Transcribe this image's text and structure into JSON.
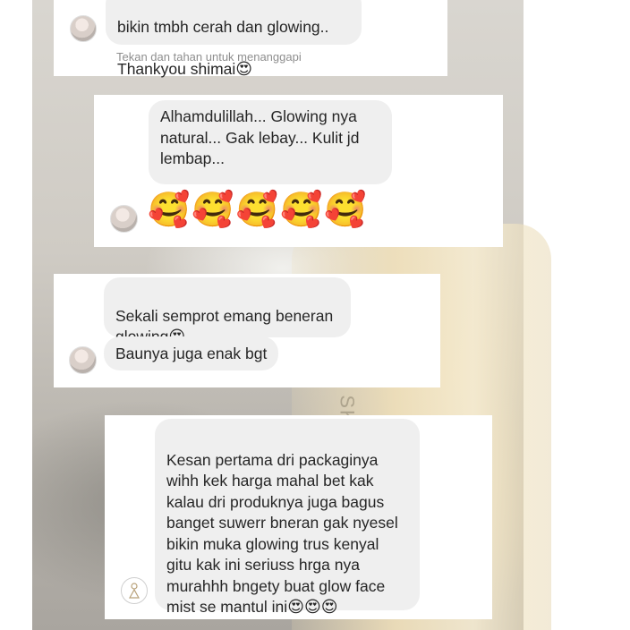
{
  "messages": [
    {
      "text_line1": "bikin tmbh  cerah dan glowing..",
      "text_line2": "Thankyou shimai",
      "emoji": "😍",
      "hint": "Tekan dan tahan untuk menanggapi"
    },
    {
      "text": "Alhamdulillah... Glowing nya\nnatural... Gak lebay... Kulit jd\nlembap...",
      "reaction_emojis": [
        "🥰",
        "🥰",
        "🥰",
        "🥰",
        "🥰"
      ]
    },
    {
      "text": "Sekali semprot emang beneran\nglowing",
      "emoji": "😍",
      "text2": "Baunya juga enak bgt"
    },
    {
      "text": "Kesan pertama dri packaginya\nwihh kek harga mahal bet kak\nkalau dri produknya juga bagus\nbanget suwerr bneran gak nyesel\nbikin muka glowing trus kenyal\ngitu kak ini seriuss hrga nya\nmurahhh bngety buat glow face\nmist se mantul ini",
      "emojis": [
        "😍",
        "😍",
        "😍"
      ]
    }
  ],
  "background_watermark": "SK"
}
